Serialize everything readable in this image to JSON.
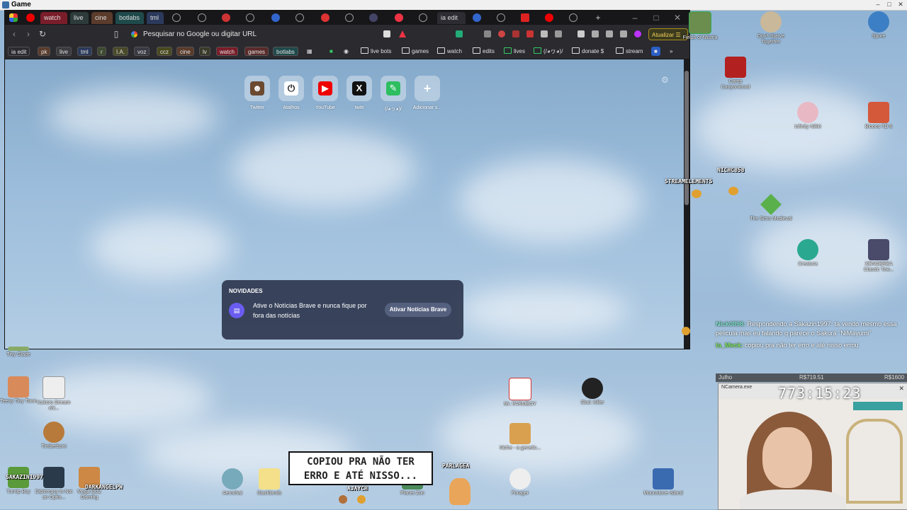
{
  "game_window": {
    "title": "Game"
  },
  "tabs": [
    {
      "label": "watch",
      "color": "#7a1d2a"
    },
    {
      "label": "live",
      "color": "#2d3b3a"
    },
    {
      "label": "cine",
      "color": "#5b3b2b"
    },
    {
      "label": "botlabs",
      "color": "#1f4a4b"
    },
    {
      "label": "tml",
      "color": "#2b3a5c"
    },
    {
      "label": "ia edit",
      "color": "#2c2c32"
    }
  ],
  "toolbar": {
    "url_placeholder": "Pesquisar no Google ou digitar URL",
    "update_label": "Atualizar"
  },
  "bookmarks": [
    {
      "label": "ia edit"
    },
    {
      "label": "pk"
    },
    {
      "label": "live"
    },
    {
      "label": "tml"
    },
    {
      "label": "r"
    },
    {
      "label": "I.A."
    },
    {
      "label": "voz"
    },
    {
      "label": "ccz"
    },
    {
      "label": "cine"
    },
    {
      "label": "lv"
    },
    {
      "label": "watch"
    },
    {
      "label": "games"
    },
    {
      "label": "botlabs"
    }
  ],
  "bookmark_folders": [
    {
      "label": "live bots"
    },
    {
      "label": "games"
    },
    {
      "label": "watch"
    },
    {
      "label": "edits"
    },
    {
      "label": "lives"
    },
    {
      "label": "(/◕ヮ◕)/"
    },
    {
      "label": "donate $"
    },
    {
      "label": "stream"
    }
  ],
  "top_sites": [
    {
      "label": "Twitter",
      "icon": "avatar-icon"
    },
    {
      "label": "Atalhos",
      "icon": "power-icon"
    },
    {
      "label": "YouTube",
      "icon": "youtube-icon"
    },
    {
      "label": "twitt",
      "icon": "x-icon"
    },
    {
      "label": "(/◕ヮ◕)/",
      "icon": "evernote-icon"
    },
    {
      "label": "Adicionar s...",
      "icon": "plus-icon"
    }
  ],
  "news_card": {
    "heading": "NOVIDADES",
    "text": "Ative o Notícias Brave e nunca fique por fora das notícias",
    "button": "Ativar Notícias Brave"
  },
  "desktop_icons_right": [
    {
      "label": "Fields of Mistria"
    },
    {
      "label": "Don't Starve Together"
    },
    {
      "label": "Spore"
    },
    {
      "label": "Camp Canyonwood"
    },
    {
      "label": "Infinity Nikki"
    },
    {
      "label": "Bloons TD 6"
    },
    {
      "label": "The Sims Medieval"
    },
    {
      "label": "Creatura"
    },
    {
      "label": "XENOBREA Classic Tow..."
    }
  ],
  "desktop_icons_left": [
    {
      "label": "Tiny Glade"
    },
    {
      "label": "Teeny Tiny Town"
    },
    {
      "label": "Kukoro Stream chi..."
    },
    {
      "label": "Timberborn"
    },
    {
      "label": "Turnip Boy"
    },
    {
      "label": "Diplomacy is Not an Optio..."
    },
    {
      "label": "Mega Quiz Gaming"
    }
  ],
  "desktop_icons_bottom": [
    {
      "label": "Aerochat"
    },
    {
      "label": "Stacklands"
    },
    {
      "label": "Planet Zoo"
    },
    {
      "label": "Mr. FARMBOY"
    },
    {
      "label": "Niche - a genetic..."
    },
    {
      "label": "Forager"
    },
    {
      "label": "Skul: Killer"
    },
    {
      "label": "Moonstone Island"
    }
  ],
  "overlay": {
    "stream_elements": "STREAMELEMENTS",
    "user_niche": "NICHC858",
    "user_sakaz": "SAKAZIN1997",
    "user_dark": "DARKANGELPW",
    "user_parl": "PARLAGEA",
    "user_ajay": "AJAYCH"
  },
  "chat": [
    {
      "user": "Nick0898:",
      "text": "Respondendo a Sakazin1997: ta vendo mesmo essa pelicula mas eu falando q parece o Sakura \"NiMayumi\"",
      "color": "#7ee0c8"
    },
    {
      "user": "ta_Meck:",
      "text": "copiou pra não ter erro e até nisso errou",
      "color": "#7be35a"
    }
  ],
  "stats": {
    "month": "Julho",
    "amount1": "R$719.51",
    "amount2": "R$1600",
    "timer": "773:15:23",
    "camera_title": "NCamera.exe"
  },
  "caption": {
    "line1": "COPIOU PRA NÃO TER",
    "line2": "ERRO E ATÉ NISSO..."
  }
}
